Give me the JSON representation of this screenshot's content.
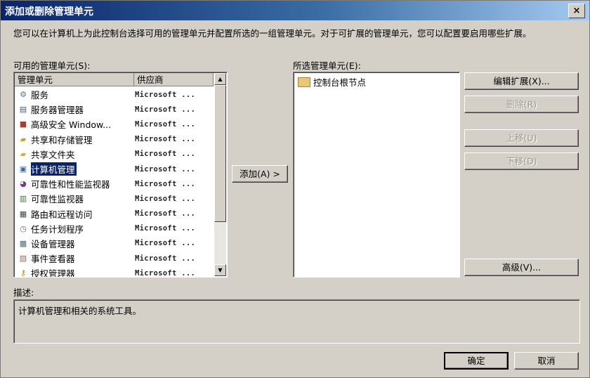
{
  "window": {
    "title": "添加或删除管理单元",
    "close_label": "×"
  },
  "intro": "您可以在计算机上为此控制台选择可用的管理单元并配置所选的一组管理单元。对于可扩展的管理单元，您可以配置要启用哪些扩展。",
  "available": {
    "label": "可用的管理单元(S):",
    "columns": [
      "管理单元",
      "供应商"
    ],
    "items": [
      {
        "name": "服务",
        "vendor": "Microsoft ...",
        "icon": "gear-icon"
      },
      {
        "name": "服务器管理器",
        "vendor": "Microsoft ...",
        "icon": "server-icon"
      },
      {
        "name": "高级安全 Window...",
        "vendor": "Microsoft ...",
        "icon": "firewall-icon"
      },
      {
        "name": "共享和存储管理",
        "vendor": "Microsoft ...",
        "icon": "shared-folder-icon"
      },
      {
        "name": "共享文件夹",
        "vendor": "Microsoft ...",
        "icon": "folder-share-icon"
      },
      {
        "name": "计算机管理",
        "vendor": "Microsoft ...",
        "icon": "computer-management-icon",
        "selected": true
      },
      {
        "name": "可靠性和性能监视器",
        "vendor": "Microsoft ...",
        "icon": "monitor-gauge-icon"
      },
      {
        "name": "可靠性监视器",
        "vendor": "Microsoft ...",
        "icon": "chart-icon"
      },
      {
        "name": "路由和远程访问",
        "vendor": "Microsoft ...",
        "icon": "network-icon"
      },
      {
        "name": "任务计划程序",
        "vendor": "Microsoft ...",
        "icon": "clock-icon"
      },
      {
        "name": "设备管理器",
        "vendor": "Microsoft ...",
        "icon": "device-icon"
      },
      {
        "name": "事件查看器",
        "vendor": "Microsoft ...",
        "icon": "event-log-icon"
      },
      {
        "name": "授权管理器",
        "vendor": "Microsoft ...",
        "icon": "key-icon"
      }
    ]
  },
  "add_button": "添加(A) >",
  "selected_panel": {
    "label": "所选管理单元(E):",
    "items": [
      {
        "name": "控制台根节点",
        "icon": "folder-icon"
      }
    ]
  },
  "buttons": {
    "edit_extensions": "编辑扩展(X)...",
    "remove": "删除(R)",
    "move_up": "上移(U)",
    "move_down": "下移(D)",
    "advanced": "高级(V)...",
    "ok": "确定",
    "cancel": "取消"
  },
  "description": {
    "label": "描述:",
    "text": "计算机管理和相关的系统工具。"
  }
}
